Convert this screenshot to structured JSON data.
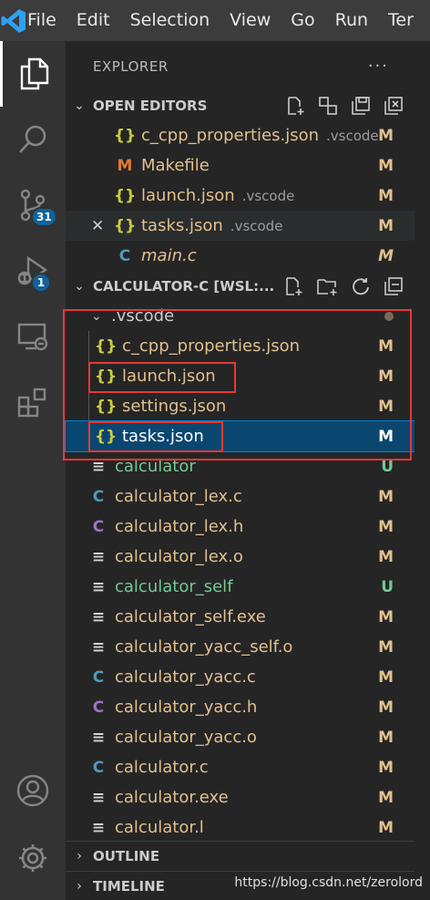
{
  "menu": [
    "File",
    "Edit",
    "Selection",
    "View",
    "Go",
    "Run",
    "Ter"
  ],
  "activity": {
    "badges": {
      "source_control": "31",
      "run_debug": "1"
    }
  },
  "explorer": {
    "title": "EXPLORER",
    "more": "···"
  },
  "open_editors": {
    "title": "OPEN EDITORS",
    "items": [
      {
        "icon": "{}",
        "name": "c_cpp_properties.json",
        "desc": ".vscode",
        "status": "M"
      },
      {
        "icon": "M",
        "name": "Makefile",
        "desc": "",
        "status": "M"
      },
      {
        "icon": "{}",
        "name": "launch.json",
        "desc": ".vscode",
        "status": "M"
      },
      {
        "icon": "{}",
        "name": "tasks.json",
        "desc": ".vscode",
        "status": "M",
        "close": "✕"
      },
      {
        "icon": "C",
        "name": "main.c",
        "desc": "",
        "status": "M"
      }
    ]
  },
  "workspace": {
    "title": "CALCULATOR-C [WSL:...",
    "folder": ".vscode",
    "folder_items": [
      {
        "icon": "{}",
        "name": "c_cpp_properties.json",
        "status": "M"
      },
      {
        "icon": "{}",
        "name": "launch.json",
        "status": "M"
      },
      {
        "icon": "{}",
        "name": "settings.json",
        "status": "M"
      },
      {
        "icon": "{}",
        "name": "tasks.json",
        "status": "M"
      }
    ],
    "files": [
      {
        "icon": "≡",
        "name": "calculator",
        "status": "U"
      },
      {
        "icon": "C",
        "name": "calculator_lex.c",
        "status": "M"
      },
      {
        "icon": "C",
        "name": "calculator_lex.h",
        "status": "M"
      },
      {
        "icon": "≡",
        "name": "calculator_lex.o",
        "status": "M"
      },
      {
        "icon": "≡",
        "name": "calculator_self",
        "status": "U"
      },
      {
        "icon": "≡",
        "name": "calculator_self.exe",
        "status": "M"
      },
      {
        "icon": "≡",
        "name": "calculator_yacc_self.o",
        "status": "M"
      },
      {
        "icon": "C",
        "name": "calculator_yacc.c",
        "status": "M"
      },
      {
        "icon": "C",
        "name": "calculator_yacc.h",
        "status": "M"
      },
      {
        "icon": "≡",
        "name": "calculator_yacc.o",
        "status": "M"
      },
      {
        "icon": "C",
        "name": "calculator.c",
        "status": "M"
      },
      {
        "icon": "≡",
        "name": "calculator.exe",
        "status": "M"
      },
      {
        "icon": "≡",
        "name": "calculator.l",
        "status": "M"
      }
    ]
  },
  "outline": {
    "title": "OUTLINE"
  },
  "timeline": {
    "title": "TIMELINE"
  },
  "watermark": "https://blog.csdn.net/zerolord"
}
